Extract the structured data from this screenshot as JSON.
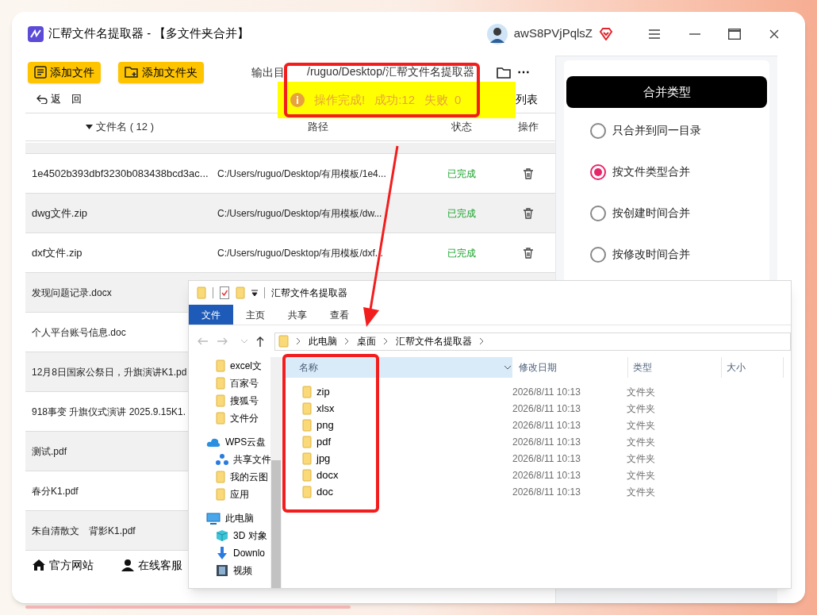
{
  "app": {
    "title": "汇帮文件名提取器 - 【多文件夹合并】",
    "username": "awS8PVjPqlsZ"
  },
  "toolbar": {
    "buttons": [
      {
        "label": "添加文件",
        "kind": "file"
      },
      {
        "label": "添加文件夹",
        "kind": "folder"
      }
    ],
    "output_label": "输出目",
    "output_path": "/ruguo/Desktop/汇帮文件名提取器",
    "more": "⋯",
    "back": "返　回",
    "view": "列表"
  },
  "toast": {
    "message": "操作完成!",
    "success_label": "成功:",
    "success": "12",
    "fail_label": "失败",
    "fail": "0"
  },
  "table": {
    "columns": [
      "文件名 ( 12 )",
      "路径",
      "状态",
      "操作"
    ],
    "rows": [
      {
        "name": "1e4502b393dbf3230b083438bcd3ac...",
        "path": "C:/Users/ruguo/Desktop/有用模板/1e4...",
        "status": "已完成"
      },
      {
        "name": "dwg文件.zip",
        "path": "C:/Users/ruguo/Desktop/有用模板/dw...",
        "status": "已完成"
      },
      {
        "name": "dxf文件.zip",
        "path": "C:/Users/ruguo/Desktop/有用模板/dxf...",
        "status": "已完成"
      },
      {
        "name": "发现问题记录.docx"
      },
      {
        "name": "个人平台账号信息.doc"
      },
      {
        "name": "12月8日国家公祭日，升旗演讲K1.pd"
      },
      {
        "name": "918事变 升旗仪式演讲 2025.9.15K1."
      },
      {
        "name": "测试.pdf"
      },
      {
        "name": "春分K1.pdf"
      },
      {
        "name": "朱自清散文　背影K1.pdf"
      }
    ]
  },
  "footer_links": [
    {
      "label": "官方网站",
      "kind": "home"
    },
    {
      "label": "在线客服",
      "kind": "service"
    }
  ],
  "merge_panel": {
    "title": "合并类型",
    "options": [
      {
        "label": "只合并到同一目录",
        "selected": false
      },
      {
        "label": "按文件类型合并",
        "selected": true
      },
      {
        "label": "按创建时间合并",
        "selected": false
      },
      {
        "label": "按修改时间合并",
        "selected": false
      }
    ]
  },
  "explorer": {
    "title": "汇帮文件名提取器",
    "ribbon_tabs": [
      {
        "label": "文件",
        "selected": true
      },
      {
        "label": "主页",
        "selected": false
      },
      {
        "label": "共享",
        "selected": false
      },
      {
        "label": "查看",
        "selected": false
      }
    ],
    "breadcrumb": [
      "此电脑",
      "桌面",
      "汇帮文件名提取器"
    ],
    "nav": [
      {
        "children": [
          {
            "label": "excel文",
            "kind": "folder"
          },
          {
            "label": "百家号",
            "kind": "folder"
          },
          {
            "label": "搜狐号",
            "kind": "folder"
          },
          {
            "label": "文件分",
            "kind": "folder"
          }
        ]
      },
      {
        "label": "WPS云盘",
        "kind": "cloud",
        "children": [
          {
            "label": "共享文件",
            "kind": "share"
          },
          {
            "label": "我的云图",
            "kind": "folder"
          },
          {
            "label": "应用",
            "kind": "folder"
          }
        ]
      },
      {
        "label": "此电脑",
        "kind": "pc",
        "children": [
          {
            "label": "3D 对象",
            "kind": "cube"
          },
          {
            "label": "Downlo",
            "kind": "download"
          },
          {
            "label": "视频",
            "kind": "video"
          }
        ]
      }
    ],
    "columns": [
      "名称",
      "修改日期",
      "类型",
      "大小"
    ],
    "rows": [
      {
        "name": "zip",
        "modified": "2026/8/11 10:13",
        "type": "文件夹"
      },
      {
        "name": "xlsx",
        "modified": "2026/8/11 10:13",
        "type": "文件夹"
      },
      {
        "name": "png",
        "modified": "2026/8/11 10:13",
        "type": "文件夹"
      },
      {
        "name": "pdf",
        "modified": "2026/8/11 10:13",
        "type": "文件夹"
      },
      {
        "name": "jpg",
        "modified": "2026/8/11 10:13",
        "type": "文件夹"
      },
      {
        "name": "docx",
        "modified": "2026/8/11 10:13",
        "type": "文件夹"
      },
      {
        "name": "doc",
        "modified": "2026/8/11 10:13",
        "type": "文件夹"
      }
    ]
  }
}
